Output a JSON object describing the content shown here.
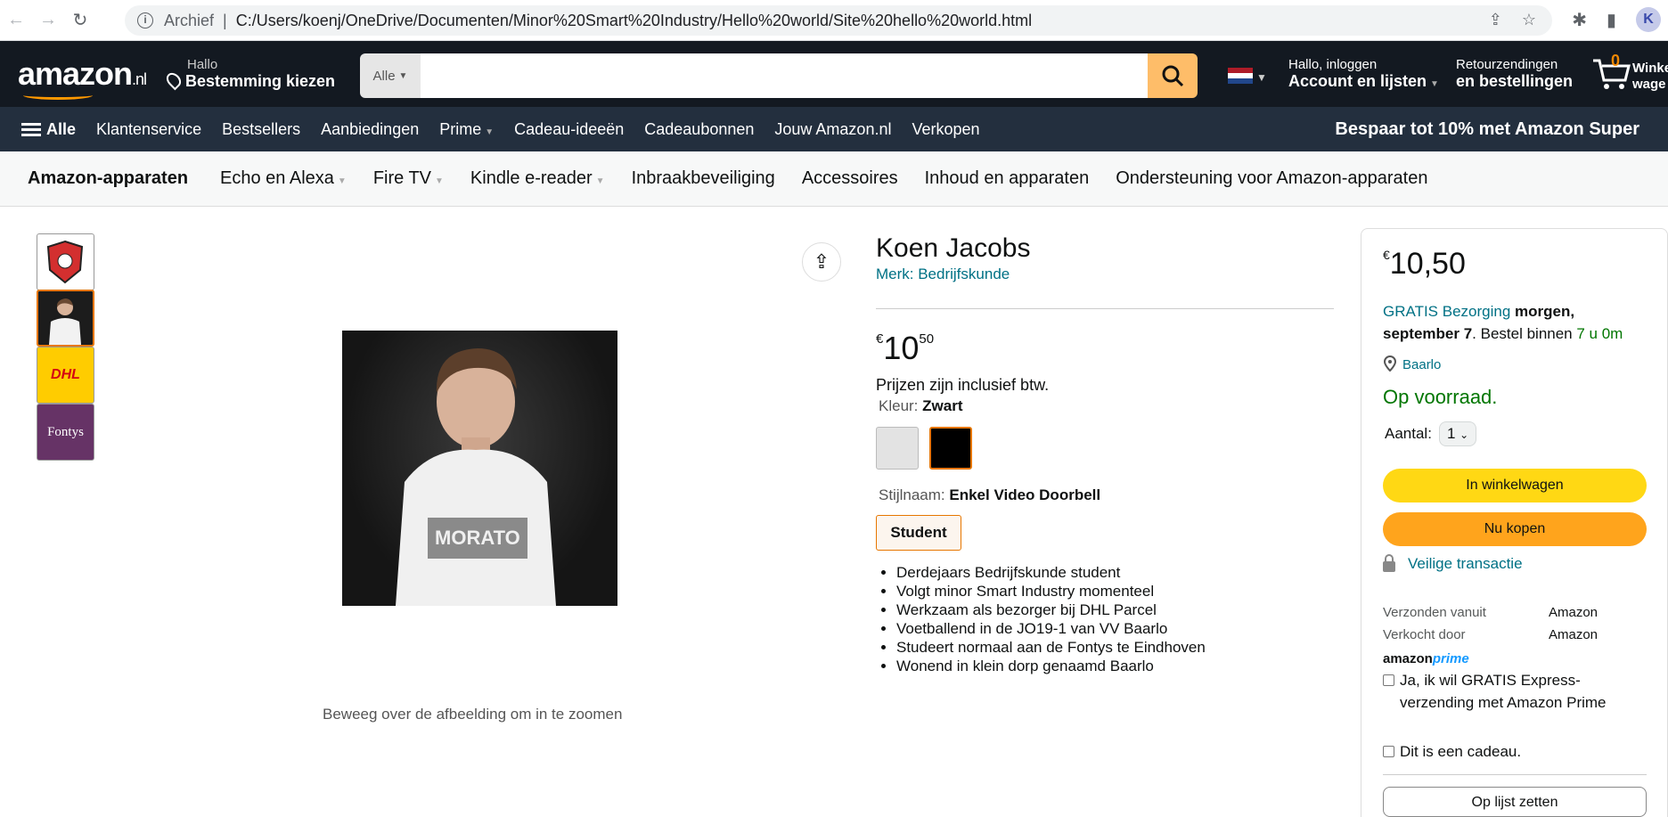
{
  "browser": {
    "archief": "Archief",
    "url": "C:/Users/koenj/OneDrive/Documenten/Minor%20Smart%20Industry/Hello%20world/Site%20hello%20world.html",
    "profile_initial": "K"
  },
  "header": {
    "logo": "amazon",
    "logo_tld": ".nl",
    "deliver_line1": "Hallo",
    "deliver_line2": "Bestemming kiezen",
    "search_category": "Alle",
    "search_placeholder": "",
    "account_line1": "Hallo, inloggen",
    "account_line2": "Account en lijsten",
    "returns_line1": "Retourzendingen",
    "returns_line2": "en bestellingen",
    "cart_count": "0",
    "cart_label": "Winke wage"
  },
  "subnav": {
    "alle": "Alle",
    "items": [
      "Klantenservice",
      "Bestsellers",
      "Aanbiedingen",
      "Prime",
      "Cadeau-ideeën",
      "Cadeaubonnen",
      "Jouw Amazon.nl",
      "Verkopen"
    ],
    "promo": "Bespaar tot 10% met Amazon Super"
  },
  "catbar": {
    "brand": "Amazon-apparaten",
    "items": [
      "Echo en Alexa",
      "Fire TV",
      "Kindle e-reader",
      "Inbraakbeveiliging",
      "Accessoires",
      "Inhoud en apparaten",
      "Ondersteuning voor Amazon-apparaten"
    ]
  },
  "product": {
    "title": "Koen Jacobs",
    "brand": "Merk: Bedrijfskunde",
    "currency": "€",
    "price_whole": "10",
    "price_fraction": "50",
    "vat": "Prijzen zijn inclusief btw.",
    "color_label": "Kleur:",
    "color_value": "Zwart",
    "style_label": "Stijlnaam:",
    "style_value": "Enkel Video Doorbell",
    "style_option": "Student",
    "bullets": [
      "Derdejaars Bedrijfskunde student",
      "Volgt minor Smart Industry momenteel",
      "Werkzaam als bezorger bij DHL Parcel",
      "Voetballend in de JO19-1 van VV Baarlo",
      "Studeert normaal aan de Fontys te Eindhoven",
      "Wonend in klein dorp genaamd Baarlo"
    ],
    "zoom_hint": "Beweeg over de afbeelding om in te zoomen",
    "thumb_labels": [
      "",
      "",
      "DHL",
      "Fontys"
    ],
    "shirt_text": "MORATO"
  },
  "buybox": {
    "currency": "€",
    "price": "10,50",
    "delivery_link": "GRATIS Bezorging",
    "delivery_day": "morgen, september 7",
    "delivery_mid": ". Bestel binnen ",
    "delivery_time": "7 u 0m",
    "location": "Baarlo",
    "stock": "Op voorraad.",
    "qty_label": "Aantal:",
    "qty_value": "1",
    "add_to_cart": "In winkelwagen",
    "buy_now": "Nu kopen",
    "secure": "Veilige transactie",
    "ships_from_label": "Verzonden vanuit",
    "ships_from_value": "Amazon",
    "sold_by_label": "Verkocht door",
    "sold_by_value": "Amazon",
    "prime_a": "amazon",
    "prime_b": "prime",
    "prime_check": "Ja, ik wil GRATIS Express-verzending met Amazon Prime",
    "gift_check": "Dit is een cadeau.",
    "add_to_list": "Op lijst zetten"
  },
  "colors": {
    "header_bg": "#131921",
    "subnav_bg": "#232f3e",
    "accent": "#febd69",
    "link": "#007185",
    "in_stock": "#007600",
    "add_to_cart": "#ffd814",
    "buy_now": "#ffa41c"
  }
}
